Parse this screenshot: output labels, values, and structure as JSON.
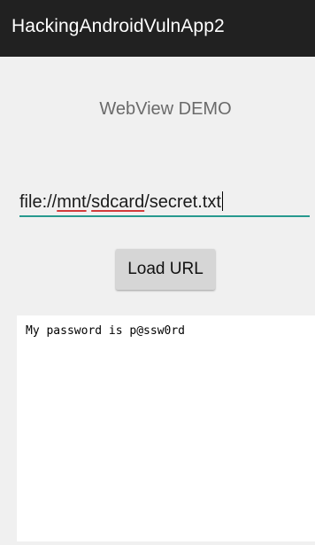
{
  "app": {
    "title": "HackingAndroidVulnApp2"
  },
  "main": {
    "heading": "WebView DEMO",
    "url_input": {
      "prefix": "file://",
      "segment1": "mnt",
      "sep1": "/",
      "segment2": "sdcard",
      "sep2": "/",
      "suffix": "secret.txt"
    },
    "load_button_label": "Load URL",
    "webview_content": "My password is p@ssw0rd"
  },
  "colors": {
    "action_bar": "#212121",
    "background": "#f0f0f0",
    "input_underline": "#26998e",
    "spellcheck_underline": "#d23b3b",
    "button": "#d6d6d6"
  }
}
